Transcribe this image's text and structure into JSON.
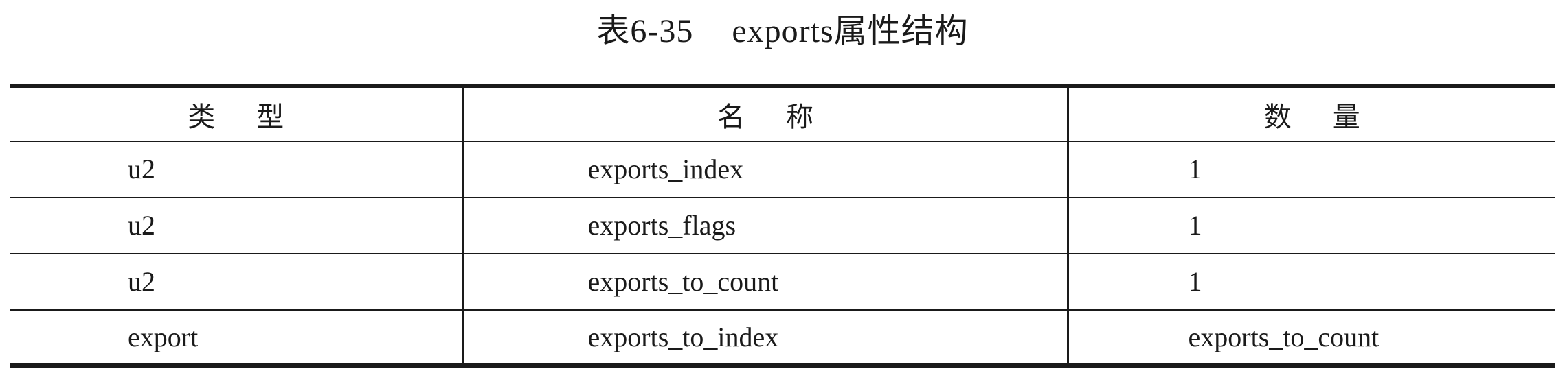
{
  "caption": {
    "number": "表6-35",
    "title": "exports属性结构"
  },
  "table": {
    "headers": [
      "类型",
      "名称",
      "数量"
    ],
    "rows": [
      [
        "u2",
        "exports_index",
        "1"
      ],
      [
        "u2",
        "exports_flags",
        "1"
      ],
      [
        "u2",
        "exports_to_count",
        "1"
      ],
      [
        "export",
        "exports_to_index",
        "exports_to_count"
      ]
    ]
  }
}
